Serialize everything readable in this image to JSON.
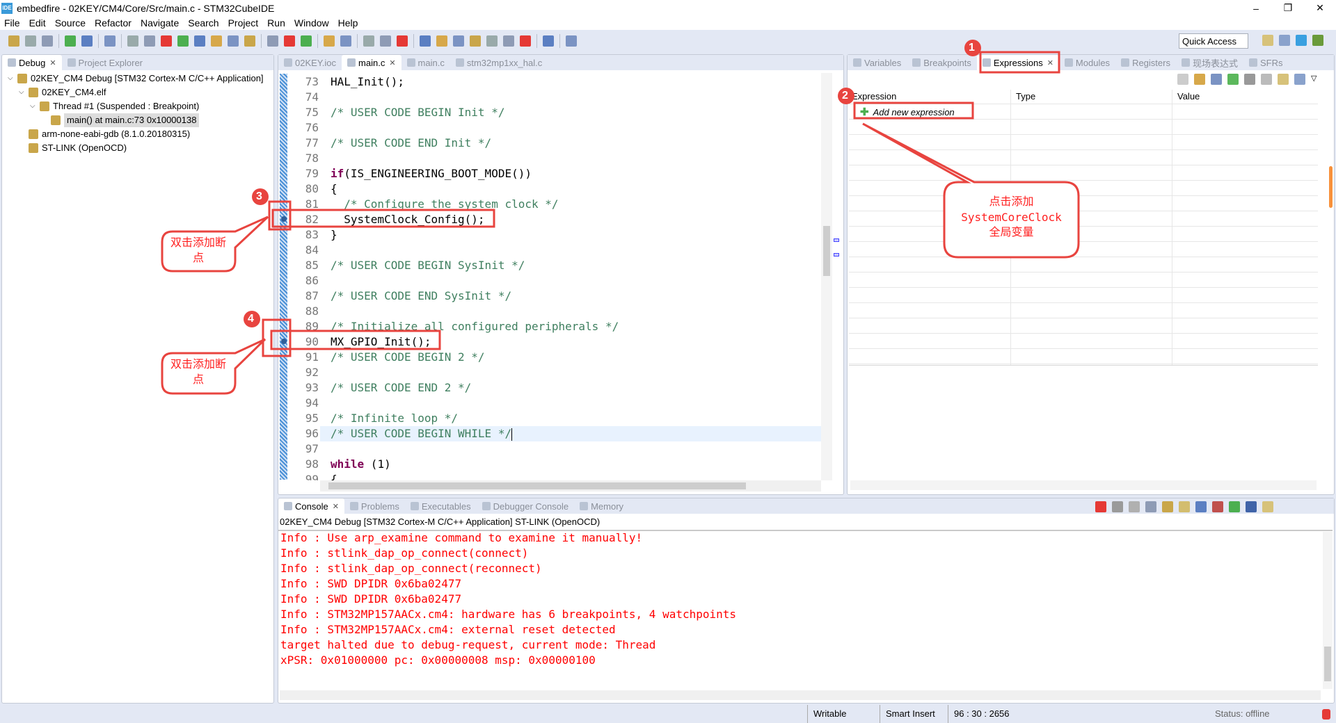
{
  "window": {
    "title": "embedfire - 02KEY/CM4/Core/Src/main.c - STM32CubeIDE",
    "logo": "IDE",
    "controls": [
      "–",
      "❐",
      "✕"
    ]
  },
  "menu": [
    "File",
    "Edit",
    "Source",
    "Refactor",
    "Navigate",
    "Search",
    "Project",
    "Run",
    "Window",
    "Help"
  ],
  "toolbar": {
    "icons": [
      "new-icon",
      "save-icon",
      "save-all-icon",
      "sep",
      "build-icon",
      "refresh-icon",
      "sep",
      "skip-breakpoints-icon",
      "sep",
      "resume-icon",
      "resume-alt-icon",
      "suspend-icon",
      "terminate-icon",
      "disconnect-icon",
      "step-into-icon",
      "step-over-icon",
      "step-return-icon",
      "sep",
      "instruction-step-icon",
      "drop-frame-icon",
      "use-step-filters-icon",
      "sep",
      "target-icon",
      "connect-icon",
      "sep",
      "debug-icon",
      "run-icon",
      "external-tools-icon",
      "sep",
      "open-type-icon",
      "pen-icon",
      "highlight-icon",
      "next-annotation-icon",
      "prev-annotation-icon",
      "back-icon",
      "forward-icon",
      "sep",
      "open-perspective-icon",
      "sep",
      "info-icon"
    ],
    "quick_access": "Quick Access",
    "perspectives": [
      "open-perspective-icon",
      "c-perspective-icon",
      "mx-perspective-icon",
      "debug-perspective-icon"
    ]
  },
  "left": {
    "tabs": [
      {
        "label": "Debug",
        "active": true
      },
      {
        "label": "Project Explorer",
        "active": false
      }
    ],
    "tree": [
      {
        "level": 0,
        "label": "02KEY_CM4 Debug [STM32 Cortex-M C/C++ Application]",
        "icon": "ide-launch-icon",
        "expanded": true
      },
      {
        "level": 1,
        "label": "02KEY_CM4.elf",
        "icon": "process-icon",
        "expanded": true
      },
      {
        "level": 2,
        "label": "Thread #1 (Suspended : Breakpoint)",
        "icon": "thread-icon",
        "expanded": true
      },
      {
        "level": 3,
        "label": "main() at main.c:73 0x10000138",
        "icon": "stack-frame-icon",
        "selected": true
      },
      {
        "level": 1,
        "label": "arm-none-eabi-gdb (8.1.0.20180315)",
        "icon": "gdb-icon"
      },
      {
        "level": 1,
        "label": "ST-LINK (OpenOCD)",
        "icon": "stlink-icon"
      }
    ]
  },
  "editor": {
    "tabs": [
      {
        "label": "02KEY.ioc",
        "icon": "mx-icon"
      },
      {
        "label": "main.c",
        "active": true,
        "closable": true
      },
      {
        "label": "main.c"
      },
      {
        "label": "stm32mp1xx_hal.c"
      }
    ],
    "lines": [
      {
        "n": "73",
        "seg": [
          [
            "pl",
            "HAL_Init();"
          ]
        ]
      },
      {
        "n": "74",
        "seg": []
      },
      {
        "n": "75",
        "seg": [
          [
            "cm",
            "/* USER CODE BEGIN Init */"
          ]
        ]
      },
      {
        "n": "76",
        "seg": []
      },
      {
        "n": "77",
        "seg": [
          [
            "cm",
            "/* USER CODE END Init */"
          ]
        ]
      },
      {
        "n": "78",
        "seg": []
      },
      {
        "n": "79",
        "seg": [
          [
            "kw",
            "if"
          ],
          [
            "pl",
            "(IS_ENGINEERING_BOOT_MODE())"
          ]
        ]
      },
      {
        "n": "80",
        "seg": [
          [
            "pl",
            "{"
          ]
        ]
      },
      {
        "n": "81",
        "seg": [
          [
            "cm",
            "  /* Configure the system clock */"
          ]
        ]
      },
      {
        "n": "82",
        "seg": [
          [
            "pl",
            "  SystemClock_Config();"
          ]
        ],
        "breakpoint": true
      },
      {
        "n": "83",
        "seg": [
          [
            "pl",
            "}"
          ]
        ]
      },
      {
        "n": "84",
        "seg": []
      },
      {
        "n": "85",
        "seg": [
          [
            "cm",
            "/* USER CODE BEGIN SysInit */"
          ]
        ]
      },
      {
        "n": "86",
        "seg": []
      },
      {
        "n": "87",
        "seg": [
          [
            "cm",
            "/* USER CODE END SysInit */"
          ]
        ]
      },
      {
        "n": "88",
        "seg": []
      },
      {
        "n": "89",
        "seg": [
          [
            "cm",
            "/* Initialize all configured peripherals */"
          ]
        ]
      },
      {
        "n": "90",
        "seg": [
          [
            "pl",
            "MX_GPIO_Init();"
          ]
        ],
        "breakpoint": true
      },
      {
        "n": "91",
        "seg": [
          [
            "cm",
            "/* USER CODE BEGIN 2 */"
          ]
        ]
      },
      {
        "n": "92",
        "seg": []
      },
      {
        "n": "93",
        "seg": [
          [
            "cm",
            "/* USER CODE END 2 */"
          ]
        ]
      },
      {
        "n": "94",
        "seg": []
      },
      {
        "n": "95",
        "seg": [
          [
            "cm",
            "/* Infinite loop */"
          ]
        ]
      },
      {
        "n": "96",
        "seg": [
          [
            "cm",
            "/* USER CODE BEGIN WHILE */"
          ]
        ],
        "current": true
      },
      {
        "n": "97",
        "seg": []
      },
      {
        "n": "98",
        "seg": [
          [
            "kw",
            "while"
          ],
          [
            "pl",
            " (1)"
          ]
        ]
      },
      {
        "n": "99",
        "seg": [
          [
            "pl",
            "{"
          ]
        ]
      }
    ]
  },
  "right": {
    "tabs": [
      {
        "label": "Variables",
        "icon": "variables-icon"
      },
      {
        "label": "Breakpoints",
        "icon": "breakpoints-icon"
      },
      {
        "label": "Expressions",
        "icon": "expressions-icon",
        "active": true
      },
      {
        "label": "Modules",
        "icon": "modules-icon"
      },
      {
        "label": "Registers",
        "icon": "registers-icon"
      },
      {
        "label": "现场表达式",
        "icon": "live-expressions-icon"
      },
      {
        "label": "SFRs",
        "icon": "sfrs-icon"
      }
    ],
    "columns": [
      "Expression",
      "Type",
      "Value"
    ],
    "add_expression": "Add new expression"
  },
  "console": {
    "tabs": [
      {
        "label": "Console",
        "active": true
      },
      {
        "label": "Problems"
      },
      {
        "label": "Executables"
      },
      {
        "label": "Debugger Console"
      },
      {
        "label": "Memory"
      }
    ],
    "header": "02KEY_CM4 Debug [STM32 Cortex-M C/C++ Application] ST-LINK (OpenOCD)",
    "lines": [
      "Info : Use arp_examine command to examine it manually!",
      "Info : stlink_dap_op_connect(connect)",
      "Info : stlink_dap_op_connect(reconnect)",
      "Info : SWD DPIDR 0x6ba02477",
      "Info : SWD DPIDR 0x6ba02477",
      "Info : STM32MP157AACx.cm4: hardware has 6 breakpoints, 4 watchpoints",
      "Info : STM32MP157AACx.cm4: external reset detected",
      "target halted due to debug-request, current mode: Thread",
      "xPSR: 0x01000000 pc: 0x00000008 msp: 0x00000100"
    ]
  },
  "status": {
    "writable": "Writable",
    "insert": "Smart Insert",
    "position": "96 : 30 : 2656",
    "offline": "Status: offline"
  },
  "annotations": {
    "badges": [
      "1",
      "2",
      "3",
      "4"
    ],
    "callout_bp1": "双击添加断点",
    "callout_bp2": "双击添加断点",
    "callout_expr_1": "点击添加",
    "callout_expr_2": "SystemCoreClock",
    "callout_expr_3": "全局变量",
    "color": "#e8443f"
  }
}
